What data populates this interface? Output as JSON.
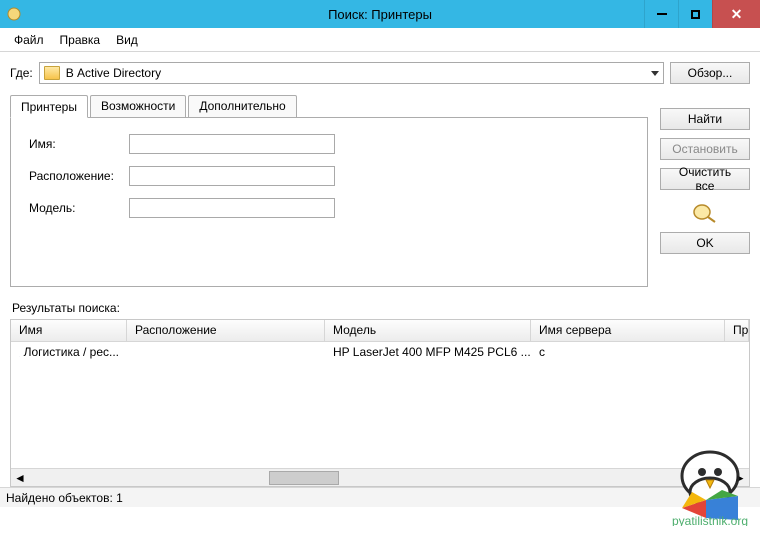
{
  "window": {
    "title": "Поиск: Принтеры"
  },
  "menu": {
    "file": "Файл",
    "edit": "Правка",
    "view": "Вид"
  },
  "where": {
    "label": "Где:",
    "value": "В Active Directory",
    "browse": "Обзор..."
  },
  "tabs": {
    "printers": "Принтеры",
    "features": "Возможности",
    "advanced": "Дополнительно"
  },
  "form": {
    "name_label": "Имя:",
    "name_value": "",
    "location_label": "Расположение:",
    "location_value": "",
    "model_label": "Модель:",
    "model_value": ""
  },
  "actions": {
    "find": "Найти",
    "stop": "Остановить",
    "clear": "Очистить все",
    "ok": "OK"
  },
  "results": {
    "label": "Результаты поиска:",
    "columns": {
      "name": "Имя",
      "location": "Расположение",
      "model": "Модель",
      "server": "Имя сервера",
      "pri": "При"
    },
    "rows": [
      {
        "name": "Логистика / рес...",
        "location": "",
        "model": "HP LaserJet 400 MFP M425 PCL6 ...",
        "server": "с"
      }
    ]
  },
  "status": {
    "text": "Найдено объектов: 1"
  },
  "watermark_text": "pyatilistnik.org"
}
